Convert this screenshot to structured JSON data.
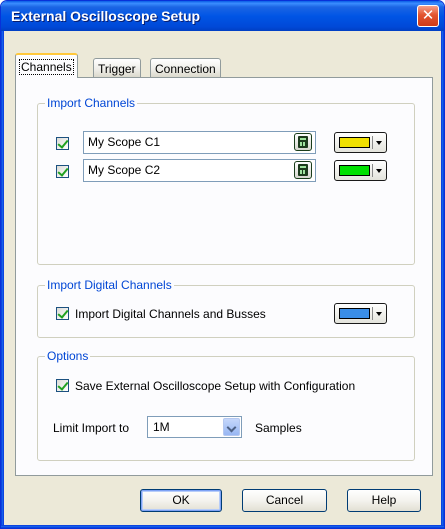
{
  "window": {
    "title": "External Oscilloscope Setup",
    "close_glyph": "✕"
  },
  "tabs": [
    {
      "label": "Channels",
      "active": true
    },
    {
      "label": "Trigger",
      "active": false
    },
    {
      "label": "Connection",
      "active": false
    }
  ],
  "import_channels": {
    "legend": "Import Channels",
    "channels": [
      {
        "name": "My Scope C1",
        "checked": true,
        "color": "#f0e000",
        "color_icon": "calculator-icon"
      },
      {
        "name": "My Scope C2",
        "checked": true,
        "color": "#00e000",
        "color_icon": "calculator-icon"
      }
    ]
  },
  "import_digital": {
    "legend": "Import Digital Channels",
    "checkbox_label": "Import Digital Channels and Busses",
    "checked": true,
    "color": "#3a8ee8"
  },
  "options": {
    "legend": "Options",
    "save_setup_label": "Save External Oscilloscope Setup with Configuration",
    "save_setup_checked": true,
    "limit_label": "Limit Import to",
    "limit_value": "1M",
    "samples_label": "Samples"
  },
  "buttons": {
    "ok": "OK",
    "cancel": "Cancel",
    "help": "Help"
  }
}
